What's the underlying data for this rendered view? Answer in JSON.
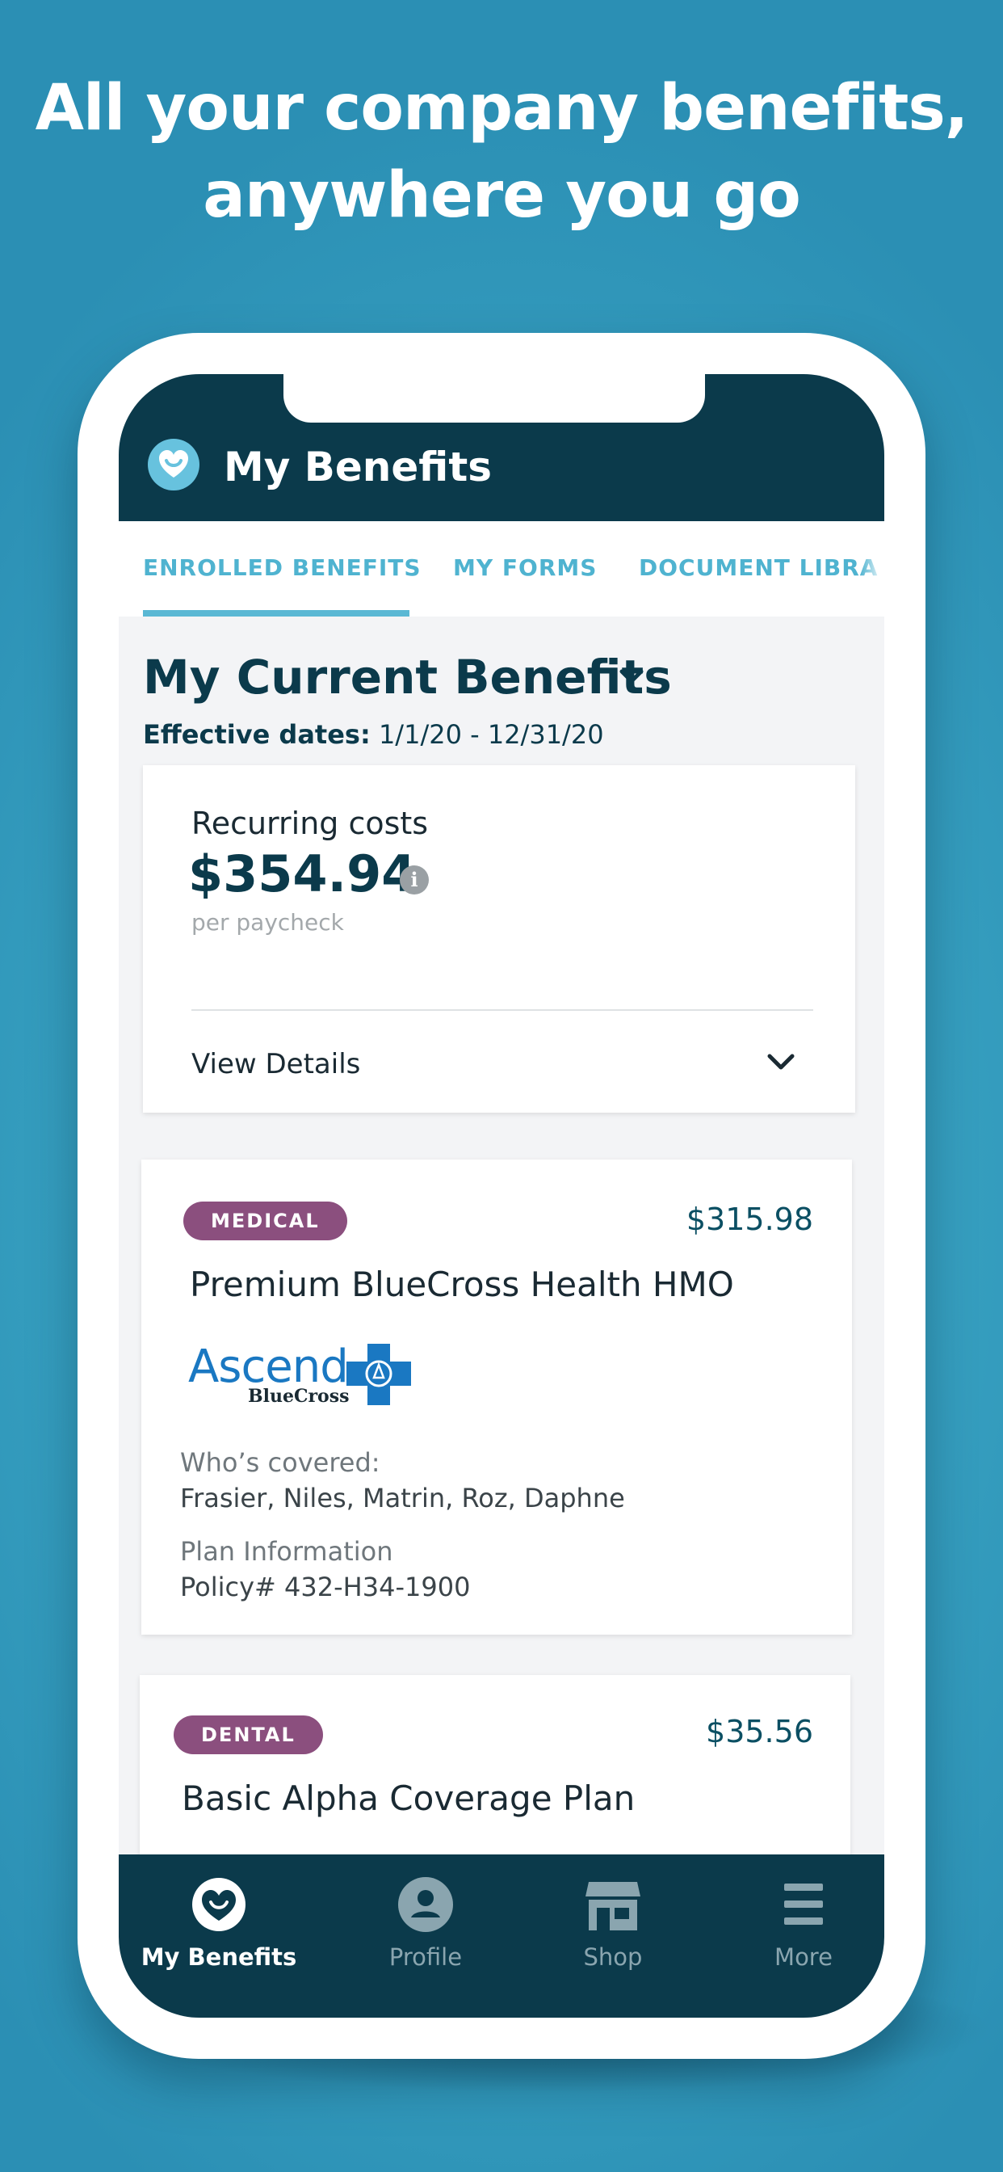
{
  "headline": {
    "line1": "All your company benefits,",
    "line2": "anywhere you go"
  },
  "app": {
    "title": "My Benefits"
  },
  "tabs": [
    {
      "label": "ENROLLED BENEFITS"
    },
    {
      "label": "MY FORMS"
    },
    {
      "label": "DOCUMENT LIBRA"
    }
  ],
  "section": {
    "title": "My Current Benefits",
    "effective_label": "Effective dates:",
    "effective_value": " 1/1/20 - 12/31/20"
  },
  "recurring": {
    "label": "Recurring costs",
    "amount": "$354.94",
    "info": "i",
    "sub": "per paycheck",
    "view_details": "View Details"
  },
  "benefits": [
    {
      "tag": "MEDICAL",
      "price": "$315.98",
      "name": "Premium BlueCross Health HMO",
      "logo_word": "Ascend",
      "logo_sub": "BlueCross",
      "covered_label": "Who’s covered:",
      "covered_value": "Frasier, Niles, Matrin, Roz, Daphne",
      "plan_label": "Plan Information",
      "plan_value": "Policy# 432-H34-1900"
    },
    {
      "tag": "DENTAL",
      "price": "$35.56",
      "name": "Basic Alpha Coverage Plan"
    }
  ],
  "nav": [
    {
      "label": "My Benefits",
      "icon": "heart-icon"
    },
    {
      "label": "Profile",
      "icon": "profile-icon"
    },
    {
      "label": "Shop",
      "icon": "store-icon"
    },
    {
      "label": "More",
      "icon": "menu-icon"
    }
  ],
  "colors": {
    "background": "#3aa5c4",
    "header": "#0b3a4b",
    "accent": "#4fb3d0",
    "tag": "#8b4f7e"
  }
}
